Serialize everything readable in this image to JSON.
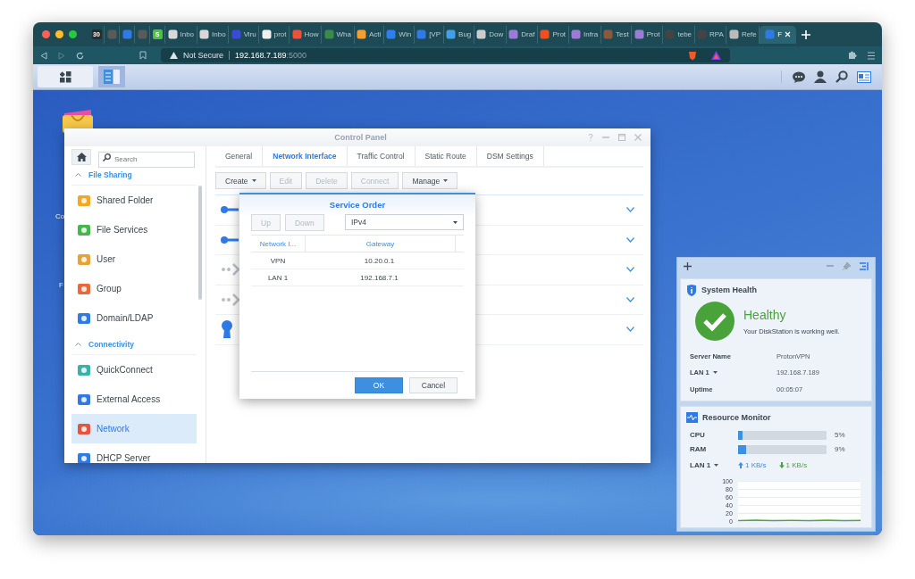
{
  "browser": {
    "tabs": [
      {
        "icon_text": "30",
        "selected": false
      },
      {
        "selected": false
      },
      {
        "selected": false
      },
      {
        "selected": false
      },
      {
        "icon_text": "S",
        "selected": false
      },
      {
        "label": "Inbo",
        "selected": false
      },
      {
        "label": "Inbo",
        "selected": false
      },
      {
        "label": "Viru",
        "selected": false
      },
      {
        "label": "prot",
        "selected": false
      },
      {
        "label": "How",
        "selected": false
      },
      {
        "label": "Wha",
        "selected": false
      },
      {
        "label": "Acti",
        "selected": false
      },
      {
        "label": "Win",
        "selected": false
      },
      {
        "label": "[VP",
        "selected": false
      },
      {
        "label": "Bug",
        "selected": false
      },
      {
        "label": "Dow",
        "selected": false
      },
      {
        "label": "Draf",
        "selected": false
      },
      {
        "label": "Prot",
        "selected": false
      },
      {
        "label": "Infra",
        "selected": false
      },
      {
        "label": "Test",
        "selected": false
      },
      {
        "label": "Prot",
        "selected": false
      },
      {
        "label": "tebe",
        "selected": false
      },
      {
        "label": "RPA",
        "selected": false
      },
      {
        "label": "Refe",
        "selected": false
      },
      {
        "label": "F",
        "selected": true
      }
    ],
    "address": {
      "warning": "Not Secure",
      "host": "192.168.7.189",
      "port": ":5000"
    }
  },
  "desktop_labels": [
    "Co",
    "F"
  ],
  "control_panel": {
    "title": "Control Panel",
    "search": {
      "placeholder": "Search"
    },
    "sidebar": [
      {
        "title": "File Sharing",
        "expanded": true,
        "items": [
          {
            "label": "Shared Folder",
            "selected": false
          },
          {
            "label": "File Services",
            "selected": false
          },
          {
            "label": "User",
            "selected": false
          },
          {
            "label": "Group",
            "selected": false
          },
          {
            "label": "Domain/LDAP",
            "selected": false
          }
        ]
      },
      {
        "title": "Connectivity",
        "expanded": true,
        "items": [
          {
            "label": "QuickConnect",
            "selected": false
          },
          {
            "label": "External Access",
            "selected": false
          },
          {
            "label": "Network",
            "selected": true
          },
          {
            "label": "DHCP Server",
            "selected": false
          }
        ]
      }
    ],
    "tabs": [
      {
        "label": "General",
        "selected": false
      },
      {
        "label": "Network Interface",
        "selected": true
      },
      {
        "label": "Traffic Control",
        "selected": false
      },
      {
        "label": "Static Route",
        "selected": false
      },
      {
        "label": "DSM Settings",
        "selected": false
      }
    ],
    "toolbar": [
      {
        "label": "Create",
        "dropdown": true,
        "disabled": false
      },
      {
        "label": "Edit",
        "dropdown": false,
        "disabled": true
      },
      {
        "label": "Delete",
        "dropdown": false,
        "disabled": true
      },
      {
        "label": "Connect",
        "dropdown": false,
        "disabled": true
      },
      {
        "label": "Manage",
        "dropdown": true,
        "disabled": false
      }
    ],
    "interfaces": [
      {
        "kind": "connected"
      },
      {
        "kind": "connected"
      },
      {
        "kind": "disconnected"
      },
      {
        "kind": "disconnected"
      },
      {
        "kind": "vpn"
      }
    ]
  },
  "dialog": {
    "title": "Service Order",
    "buttons": [
      {
        "label": "Up",
        "disabled": true
      },
      {
        "label": "Down",
        "disabled": true
      }
    ],
    "protocol": "IPv4",
    "columns": [
      "Network I...",
      "Gateway"
    ],
    "rows": [
      [
        "VPN",
        "10.20.0.1"
      ],
      [
        "LAN 1",
        "192.168.7.1"
      ]
    ],
    "actions": [
      {
        "label": "OK",
        "kind": "primary"
      },
      {
        "label": "Cancel",
        "kind": "secondary"
      }
    ]
  },
  "widgets": {
    "system_health": {
      "title": "System Health",
      "status": "Healthy",
      "message": "Your DiskStation is working well.",
      "rows": [
        {
          "label": "Server Name",
          "value": "ProtonVPN",
          "dropdown": false
        },
        {
          "label": "LAN 1",
          "value": "192.168.7.189",
          "dropdown": true
        },
        {
          "label": "Uptime",
          "value": "00:05:07",
          "dropdown": false
        }
      ]
    },
    "resource_monitor": {
      "title": "Resource Monitor",
      "meters": [
        {
          "label": "CPU",
          "level": 0.05,
          "reading": "5%"
        },
        {
          "label": "RAM",
          "level": 0.09,
          "reading": "9%"
        }
      ],
      "network": {
        "label": "LAN 1",
        "dropdown": true,
        "upload": "1 KB/s",
        "download": "1 KB/s"
      },
      "axis_labels": [
        "100",
        "80",
        "60",
        "40",
        "20",
        "0"
      ]
    }
  }
}
